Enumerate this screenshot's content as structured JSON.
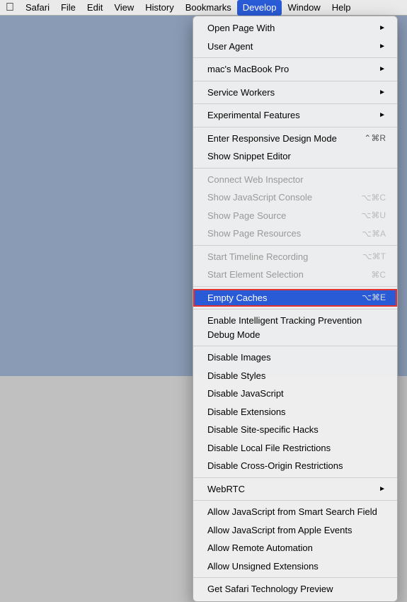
{
  "menubar": {
    "apple_icon": "🍎",
    "items": [
      {
        "label": "Safari",
        "active": false
      },
      {
        "label": "File",
        "active": false
      },
      {
        "label": "Edit",
        "active": false
      },
      {
        "label": "View",
        "active": false
      },
      {
        "label": "History",
        "active": false
      },
      {
        "label": "Bookmarks",
        "active": false
      },
      {
        "label": "Develop",
        "active": true
      },
      {
        "label": "Window",
        "active": false
      },
      {
        "label": "Help",
        "active": false
      }
    ]
  },
  "menu": {
    "items": [
      {
        "type": "item",
        "label": "Open Page With",
        "shortcut": "",
        "arrow": true,
        "disabled": false
      },
      {
        "type": "item",
        "label": "User Agent",
        "shortcut": "",
        "arrow": true,
        "disabled": false
      },
      {
        "type": "separator"
      },
      {
        "type": "item",
        "label": "mac's MacBook Pro",
        "shortcut": "",
        "arrow": true,
        "disabled": false
      },
      {
        "type": "separator"
      },
      {
        "type": "item",
        "label": "Service Workers",
        "shortcut": "",
        "arrow": true,
        "disabled": false
      },
      {
        "type": "separator"
      },
      {
        "type": "item",
        "label": "Experimental Features",
        "shortcut": "",
        "arrow": true,
        "disabled": false
      },
      {
        "type": "separator"
      },
      {
        "type": "item",
        "label": "Enter Responsive Design Mode",
        "shortcut": "⌃⌘R",
        "disabled": false
      },
      {
        "type": "item",
        "label": "Show Snippet Editor",
        "shortcut": "",
        "disabled": false
      },
      {
        "type": "separator"
      },
      {
        "type": "item",
        "label": "Connect Web Inspector",
        "shortcut": "",
        "disabled": true
      },
      {
        "type": "item",
        "label": "Show JavaScript Console",
        "shortcut": "⌥⌘C",
        "disabled": true
      },
      {
        "type": "item",
        "label": "Show Page Source",
        "shortcut": "⌥⌘U",
        "disabled": true
      },
      {
        "type": "item",
        "label": "Show Page Resources",
        "shortcut": "⌥⌘A",
        "disabled": true
      },
      {
        "type": "separator"
      },
      {
        "type": "item",
        "label": "Start Timeline Recording",
        "shortcut": "⌥⌘T",
        "disabled": true
      },
      {
        "type": "item",
        "label": "Start Element Selection",
        "shortcut": "⌘C",
        "disabled": true
      },
      {
        "type": "separator"
      },
      {
        "type": "item",
        "label": "Empty Caches",
        "shortcut": "⌥⌘E",
        "highlighted": true,
        "disabled": false
      },
      {
        "type": "separator"
      },
      {
        "type": "item",
        "label": "Enable Intelligent Tracking Prevention Debug Mode",
        "shortcut": "",
        "disabled": false
      },
      {
        "type": "separator"
      },
      {
        "type": "item",
        "label": "Disable Images",
        "shortcut": "",
        "disabled": false
      },
      {
        "type": "item",
        "label": "Disable Styles",
        "shortcut": "",
        "disabled": false
      },
      {
        "type": "item",
        "label": "Disable JavaScript",
        "shortcut": "",
        "disabled": false
      },
      {
        "type": "item",
        "label": "Disable Extensions",
        "shortcut": "",
        "disabled": false
      },
      {
        "type": "item",
        "label": "Disable Site-specific Hacks",
        "shortcut": "",
        "disabled": false
      },
      {
        "type": "item",
        "label": "Disable Local File Restrictions",
        "shortcut": "",
        "disabled": false
      },
      {
        "type": "item",
        "label": "Disable Cross-Origin Restrictions",
        "shortcut": "",
        "disabled": false
      },
      {
        "type": "separator"
      },
      {
        "type": "item",
        "label": "WebRTC",
        "shortcut": "",
        "arrow": true,
        "disabled": false
      },
      {
        "type": "separator"
      },
      {
        "type": "item",
        "label": "Allow JavaScript from Smart Search Field",
        "shortcut": "",
        "disabled": false
      },
      {
        "type": "item",
        "label": "Allow JavaScript from Apple Events",
        "shortcut": "",
        "disabled": false
      },
      {
        "type": "item",
        "label": "Allow Remote Automation",
        "shortcut": "",
        "disabled": false
      },
      {
        "type": "item",
        "label": "Allow Unsigned Extensions",
        "shortcut": "",
        "disabled": false
      },
      {
        "type": "separator"
      },
      {
        "type": "item",
        "label": "Get Safari Technology Preview",
        "shortcut": "",
        "disabled": false
      }
    ]
  }
}
